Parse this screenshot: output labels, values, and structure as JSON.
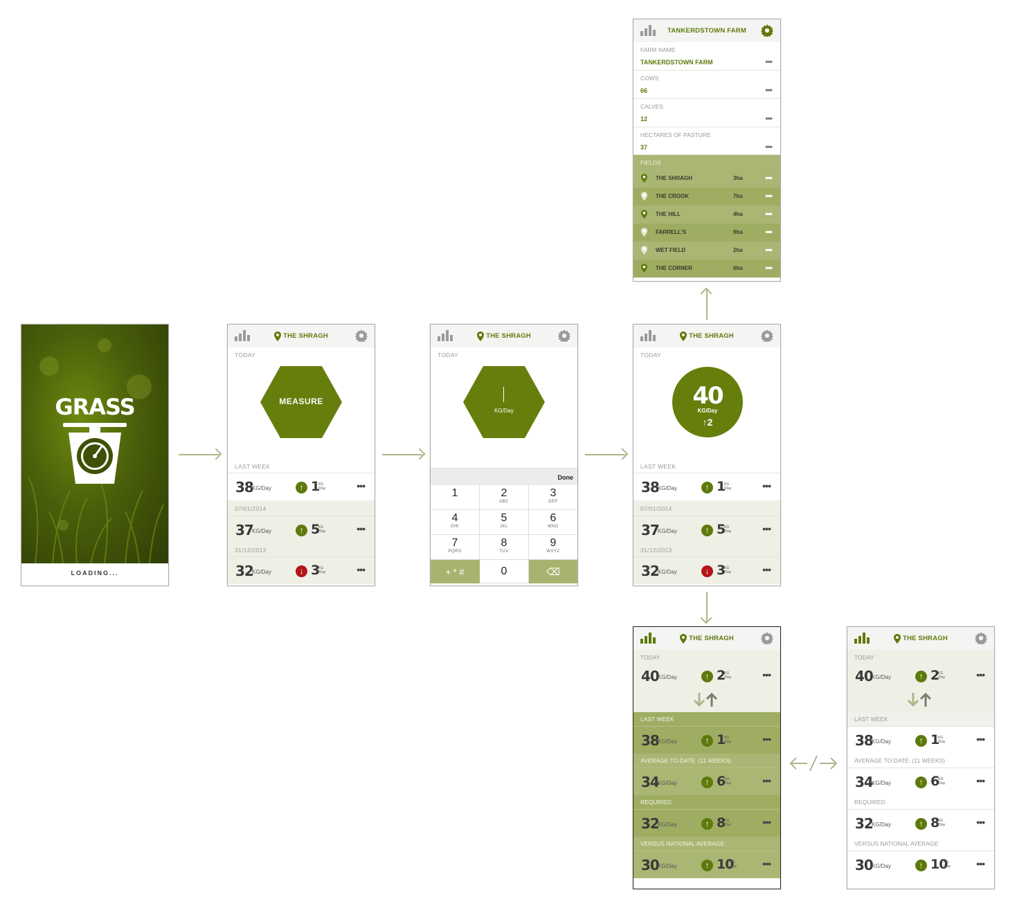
{
  "splash": {
    "logo": "GRASS",
    "loading": "LOADING..."
  },
  "topbar_title": "THE SHRAGH",
  "farm_title": "TANKERDSTOWN FARM",
  "labels": {
    "today": "TODAY",
    "last_week": "LAST WEEK",
    "d1": "07/01/2014",
    "d2": "31/12/2013",
    "avg": "AVERAGE TO DATE: (11 WEEKS)",
    "required": "REQUIRED",
    "national": "VERSUS NATIONAL AVERAGE",
    "unit": "KG/Day",
    "dunit_kg": "KG",
    "dunit_day": "/Day",
    "dots": "•••"
  },
  "measure": {
    "button": "MEASURE",
    "unit": "KG/Day",
    "done": "Done"
  },
  "result": {
    "value": "40",
    "unit": "KG/Day",
    "delta": "↑2"
  },
  "history": [
    {
      "value": "38",
      "delta": "1",
      "dir": "up"
    },
    {
      "value": "37",
      "delta": "5",
      "dir": "up"
    },
    {
      "value": "32",
      "delta": "3",
      "dir": "down"
    }
  ],
  "comparison": [
    {
      "value": "40",
      "delta": "2"
    },
    {
      "value": "38",
      "delta": "1"
    },
    {
      "value": "34",
      "delta": "6"
    },
    {
      "value": "32",
      "delta": "8"
    },
    {
      "value": "30",
      "delta": "10"
    }
  ],
  "keypad": {
    "keys": [
      {
        "n": "1",
        "l": ""
      },
      {
        "n": "2",
        "l": "ABC"
      },
      {
        "n": "3",
        "l": "DEF"
      },
      {
        "n": "4",
        "l": "GHI"
      },
      {
        "n": "5",
        "l": "JKL"
      },
      {
        "n": "6",
        "l": "MNO"
      },
      {
        "n": "7",
        "l": "PQRS"
      },
      {
        "n": "8",
        "l": "TUV"
      },
      {
        "n": "9",
        "l": "WXYZ"
      },
      {
        "n": "+ * #",
        "l": ""
      },
      {
        "n": "0",
        "l": ""
      },
      {
        "n": "⌫",
        "l": ""
      }
    ]
  },
  "farm": {
    "name_label": "FARM NAME",
    "name": "TANKERDSTOWN FARM",
    "cows_label": "COWS",
    "cows": "66",
    "calves_label": "CALVES",
    "calves": "12",
    "hectares_label": "HECTARES OF PASTURE",
    "hectares": "37",
    "fields_label": "FIELDS",
    "fields": [
      {
        "name": "THE SHRAGH",
        "ha": "3ha",
        "active": true
      },
      {
        "name": "THE CROOK",
        "ha": "7ha",
        "active": false
      },
      {
        "name": "THE HILL",
        "ha": "4ha",
        "active": true
      },
      {
        "name": "FARRELL'S",
        "ha": "9ha",
        "active": false
      },
      {
        "name": "WET FIELD",
        "ha": "2ha",
        "active": false
      },
      {
        "name": "THE CORNER",
        "ha": "6ha",
        "active": true
      }
    ]
  },
  "colors": {
    "brand": "#5e7a0c",
    "down": "#b3151a",
    "connector": "#a9b788"
  }
}
